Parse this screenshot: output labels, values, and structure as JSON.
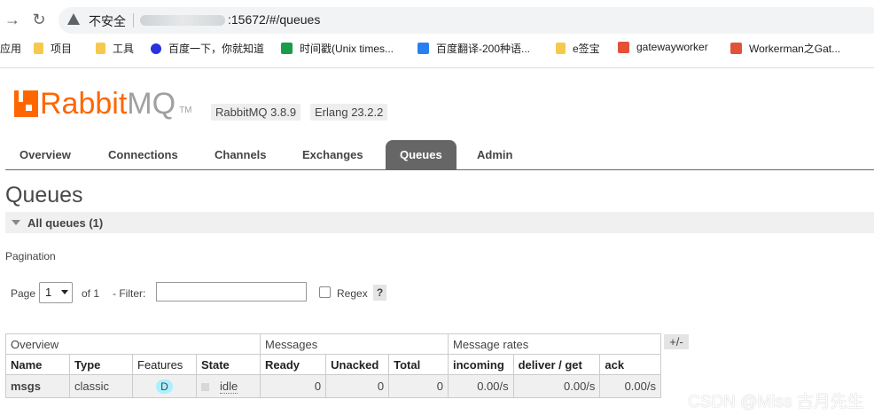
{
  "browser": {
    "back_icon": "back-arrow-icon",
    "reload_icon": "reload-icon",
    "security_label": "不安全",
    "url": ":15672/#/queues"
  },
  "bookmarks": [
    {
      "label": "应用",
      "icon": "apps-grid-icon"
    },
    {
      "label": "项目",
      "icon": "folder-icon"
    },
    {
      "label": "工具",
      "icon": "folder-icon"
    },
    {
      "label": "百度一下，你就知道",
      "icon": "baidu-paw-icon"
    },
    {
      "label": "时间戳(Unix times...",
      "icon": "timestamp-icon"
    },
    {
      "label": "百度翻译-200种语...",
      "icon": "translate-icon"
    },
    {
      "label": "e签宝",
      "icon": "folder-icon"
    },
    {
      "label": "gatewayworker",
      "icon": "c-logo-icon"
    },
    {
      "label": "Workerman之Gat...",
      "icon": "c-logo-icon"
    }
  ],
  "app": {
    "logo_rabbit": "Rabbit",
    "logo_mq": "MQ",
    "logo_tm": "TM",
    "rabbitmq_version": "RabbitMQ 3.8.9",
    "erlang_version": "Erlang 23.2.2"
  },
  "tabs": [
    "Overview",
    "Connections",
    "Channels",
    "Exchanges",
    "Queues",
    "Admin"
  ],
  "page_title": "Queues",
  "section_title": "All queues (1)",
  "pagination": {
    "title": "Pagination",
    "page_label": "Page",
    "page_value": "1",
    "of_label": "of 1",
    "filter_label": "- Filter:",
    "filter_value": "",
    "regex_label": "Regex",
    "help_label": "?"
  },
  "table": {
    "groups": [
      "Overview",
      "Messages",
      "Message rates"
    ],
    "columns": [
      "Name",
      "Type",
      "Features",
      "State",
      "Ready",
      "Unacked",
      "Total",
      "incoming",
      "deliver / get",
      "ack"
    ],
    "rows": [
      {
        "name": "msgs",
        "type": "classic",
        "features": "D",
        "state": "idle",
        "ready": "0",
        "unacked": "0",
        "total": "0",
        "incoming": "0.00/s",
        "deliver_get": "0.00/s",
        "ack": "0.00/s"
      }
    ],
    "toggle_label": "+/-"
  },
  "watermark": "CSDN @Miss 古月先生",
  "colors": {
    "brand": "#ff6600",
    "tab_active": "#666666",
    "feature_badge": "#aaf0ff"
  }
}
